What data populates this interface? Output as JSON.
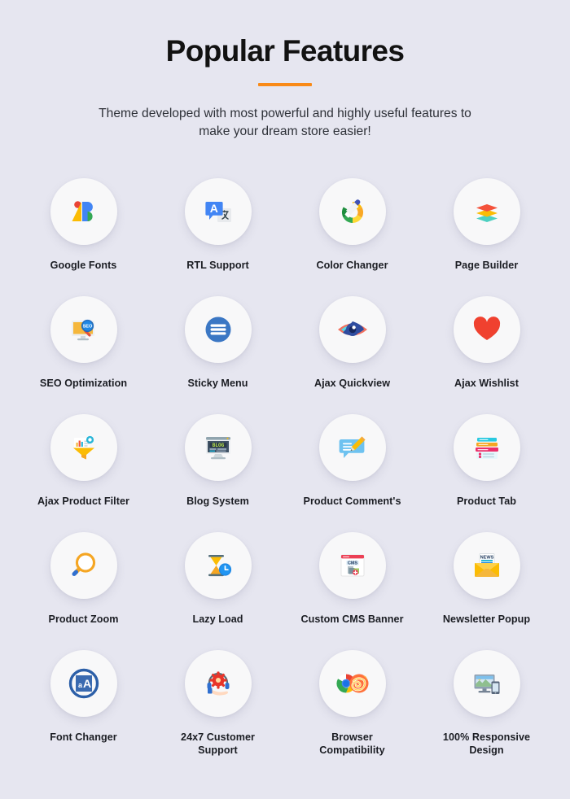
{
  "header": {
    "title": "Popular Features",
    "accent_color": "#f98a17",
    "subtitle": "Theme developed with most powerful and highly useful features to make your dream store easier!"
  },
  "background_color": "#e6e6f0",
  "circle_color": "#f8f8f9",
  "label_color": "#1b1d23",
  "features": [
    {
      "label": "Google Fonts",
      "icon": "google-fonts-icon"
    },
    {
      "label": "RTL Support",
      "icon": "translate-icon"
    },
    {
      "label": "Color Changer",
      "icon": "eyedropper-color-wheel-icon"
    },
    {
      "label": "Page Builder",
      "icon": "layers-icon"
    },
    {
      "label": "SEO Optimization",
      "icon": "seo-monitor-magnifier-icon"
    },
    {
      "label": "Sticky Menu",
      "icon": "hamburger-menu-icon"
    },
    {
      "label": "Ajax Quickview",
      "icon": "eye-icon"
    },
    {
      "label": "Ajax Wishlist",
      "icon": "heart-icon"
    },
    {
      "label": "Ajax Product Filter",
      "icon": "funnel-chart-icon"
    },
    {
      "label": "Blog System",
      "icon": "blog-monitor-icon"
    },
    {
      "label": "Product Comment's",
      "icon": "comment-pencil-icon"
    },
    {
      "label": "Product Tab",
      "icon": "tabs-panel-icon"
    },
    {
      "label": "Product Zoom",
      "icon": "magnifier-icon"
    },
    {
      "label": "Lazy Load",
      "icon": "hourglass-clock-icon"
    },
    {
      "label": "Custom CMS Banner",
      "icon": "cms-browser-icon"
    },
    {
      "label": "Newsletter Popup",
      "icon": "newsletter-envelope-icon"
    },
    {
      "label": "Font Changer",
      "icon": "font-size-icon"
    },
    {
      "label": "24x7 Customer\nSupport",
      "icon": "headset-support-icon"
    },
    {
      "label": "Browser\nCompatibility",
      "icon": "browsers-icon"
    },
    {
      "label": "100% Responsive\nDesign",
      "icon": "responsive-devices-icon"
    }
  ]
}
